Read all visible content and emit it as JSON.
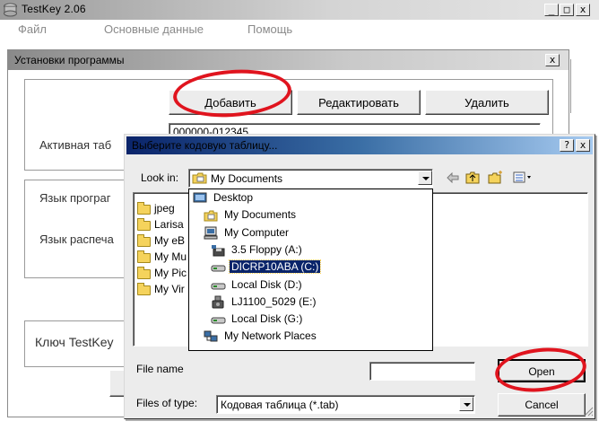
{
  "app": {
    "title": "TestKey 2.06",
    "menu": [
      "Файл",
      "Основные данные",
      "Помощь"
    ],
    "caption_buttons": [
      "_",
      "□",
      "x"
    ]
  },
  "settings": {
    "title": "Установки программы",
    "close_label": "x",
    "buttons": {
      "add": "Добавить",
      "edit": "Редактировать",
      "delete": "Удалить"
    },
    "active_table_label": "Активная таб",
    "active_table_value": "000000-012345",
    "program_lang_label": "Язык програг",
    "print_lang_label": "Язык распеча",
    "key_label": "Ключ TestKey"
  },
  "file_dialog": {
    "title": "Выберите кодовую таблицу...",
    "help_label": "?",
    "close_label": "x",
    "look_in_label": "Look in:",
    "look_in_value": "My Documents",
    "toolbar_icons": [
      "back-arrow-icon",
      "up-folder-icon",
      "new-folder-icon",
      "view-menu-icon"
    ],
    "folders": [
      "jpeg",
      "Larisa",
      "My eB",
      "My Mu",
      "My Pic",
      "My Vir"
    ],
    "dropdown_items": [
      {
        "label": "Desktop",
        "icon": "desktop-icon",
        "indent": 0,
        "selected": false
      },
      {
        "label": "My Documents",
        "icon": "my-documents-icon",
        "indent": 1,
        "selected": false
      },
      {
        "label": "My Computer",
        "icon": "my-computer-icon",
        "indent": 1,
        "selected": false
      },
      {
        "label": "3.5 Floppy (A:)",
        "icon": "floppy-icon",
        "indent": 2,
        "selected": false
      },
      {
        "label": "DICRP10ABA (C:)",
        "icon": "hard-drive-icon",
        "indent": 2,
        "selected": true
      },
      {
        "label": "Local Disk (D:)",
        "icon": "hard-drive-icon",
        "indent": 2,
        "selected": false
      },
      {
        "label": "LJ1100_5029 (E:)",
        "icon": "removable-drive-icon",
        "indent": 2,
        "selected": false
      },
      {
        "label": "Local Disk (G:)",
        "icon": "hard-drive-icon",
        "indent": 2,
        "selected": false
      },
      {
        "label": "My Network Places",
        "icon": "network-places-icon",
        "indent": 1,
        "selected": false
      }
    ],
    "file_name_label": "File name",
    "file_name_value": "",
    "files_of_type_label": "Files of type:",
    "files_of_type_value": "Кодовая таблица (*.tab)",
    "open_label": "Open",
    "cancel_label": "Cancel"
  },
  "annotations": {
    "ring_color": "#e0141e"
  }
}
